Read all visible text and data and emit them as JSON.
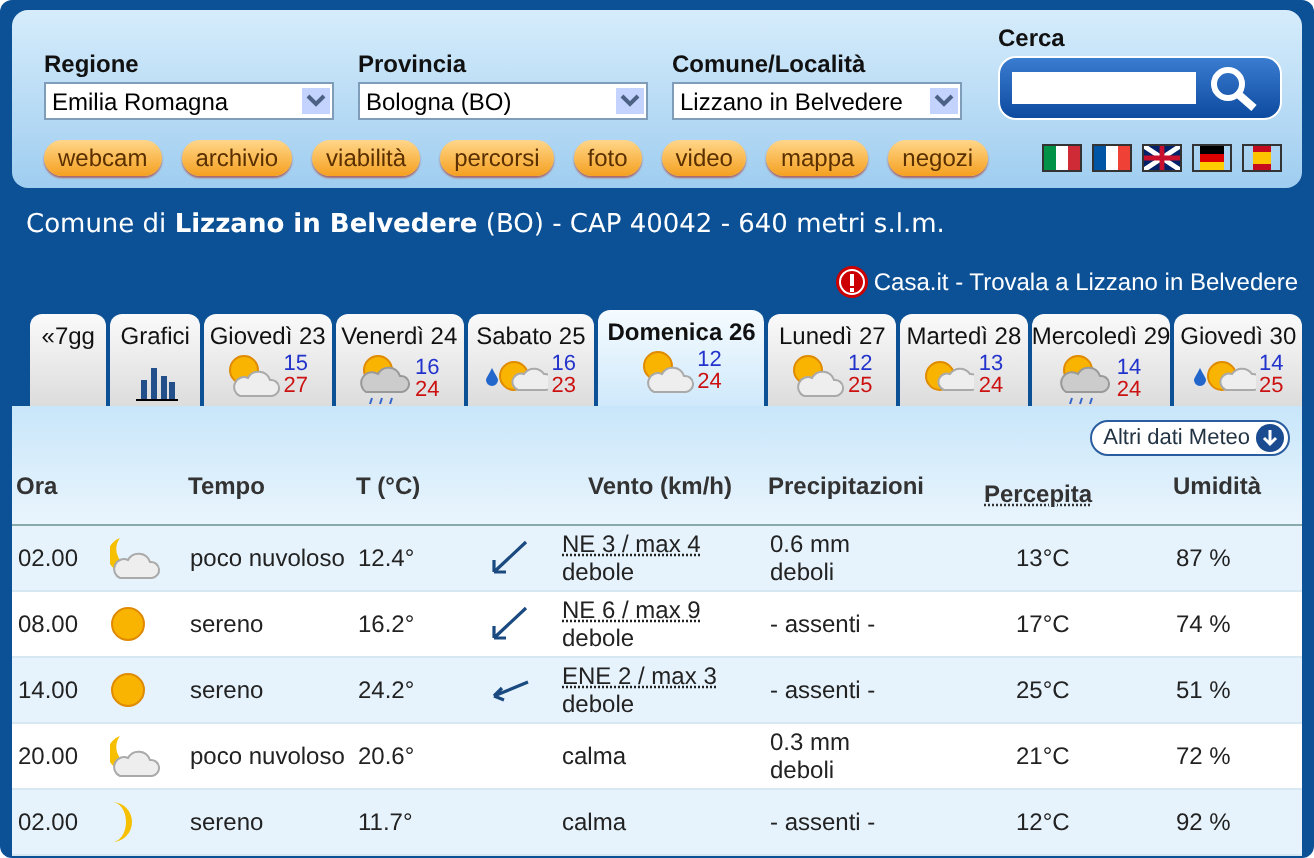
{
  "selectors": [
    {
      "label": "Regione",
      "value": "Emilia Romagna"
    },
    {
      "label": "Provincia",
      "value": "Bologna (BO)"
    },
    {
      "label": "Comune/Località",
      "value": "Lizzano in Belvedere"
    }
  ],
  "search": {
    "label": "Cerca"
  },
  "links": [
    "webcam",
    "archivio",
    "viabilità",
    "percorsi",
    "foto",
    "video",
    "mappa",
    "negozi"
  ],
  "heading": "Comune di **Lizzano in Belvedere** (BO) - CAP 40042 - 640 metri s.l.m.",
  "promo": "Casa.it - Trovala a Lizzano in Belvedere",
  "tabs": [
    {
      "kind": "week",
      "label": "«7gg",
      "selected": false
    },
    {
      "kind": "chart",
      "label": "Grafici",
      "selected": false
    },
    {
      "kind": "partly",
      "label": "Giovedì 23",
      "rain": false,
      "min": "15",
      "max": "27",
      "selected": false
    },
    {
      "kind": "showers",
      "label": "Venerdì 24",
      "rain": false,
      "min": "16",
      "max": "24",
      "selected": false
    },
    {
      "kind": "cloudsun",
      "label": "Sabato 25",
      "rain": true,
      "min": "16",
      "max": "23",
      "selected": false
    },
    {
      "kind": "partly",
      "label": "Domenica 26",
      "rain": false,
      "min": "12",
      "max": "24",
      "selected": true
    },
    {
      "kind": "partly",
      "label": "Lunedì 27",
      "rain": false,
      "min": "12",
      "max": "25",
      "selected": false
    },
    {
      "kind": "cloudsun",
      "label": "Martedì 28",
      "rain": false,
      "min": "13",
      "max": "24",
      "selected": false
    },
    {
      "kind": "showers",
      "label": "Mercoledì 29",
      "rain": false,
      "min": "14",
      "max": "24",
      "selected": false
    },
    {
      "kind": "cloudsun",
      "label": "Giovedì 30",
      "rain": true,
      "min": "14",
      "max": "25",
      "selected": false
    }
  ],
  "more_button": "Altri dati Meteo",
  "columns": [
    "Ora",
    "Tempo",
    "T (°C)",
    "Vento (km/h)",
    "Precipitazioni",
    "Percepita",
    "Umidità"
  ],
  "rows": [
    {
      "kind": "moonsun",
      "time": "02.00",
      "sky": "poco nuvoloso",
      "temp": "12.4°",
      "wind": "NE 3 / max 4",
      "strength": "debole",
      "rain": "0.6 mm",
      "rain_note": "deboli",
      "feels": "13°C",
      "humidity": "87 %"
    },
    {
      "kind": "sun",
      "time": "08.00",
      "sky": "sereno",
      "temp": "16.2°",
      "wind": "NE 6 / max 9",
      "strength": "debole",
      "rain": "- assenti -",
      "feels": "17°C",
      "humidity": "74 %"
    },
    {
      "kind": "sun",
      "time": "14.00",
      "sky": "sereno",
      "temp": "24.2°",
      "wind": "ENE 2 / max 3",
      "strength": "debole",
      "rain": "- assenti -",
      "feels": "25°C",
      "humidity": "51 %"
    },
    {
      "kind": "moonsun",
      "time": "20.00",
      "sky": "poco nuvoloso",
      "temp": "20.6°",
      "wind": "calma",
      "rain": "0.3 mm",
      "rain_note": "deboli",
      "feels": "21°C",
      "humidity": "72 %"
    },
    {
      "kind": "moon",
      "time": "02.00",
      "sky": "sereno",
      "temp": "11.7°",
      "wind": "calma",
      "rain": "- assenti -",
      "feels": "12°C",
      "humidity": "92 %"
    }
  ]
}
